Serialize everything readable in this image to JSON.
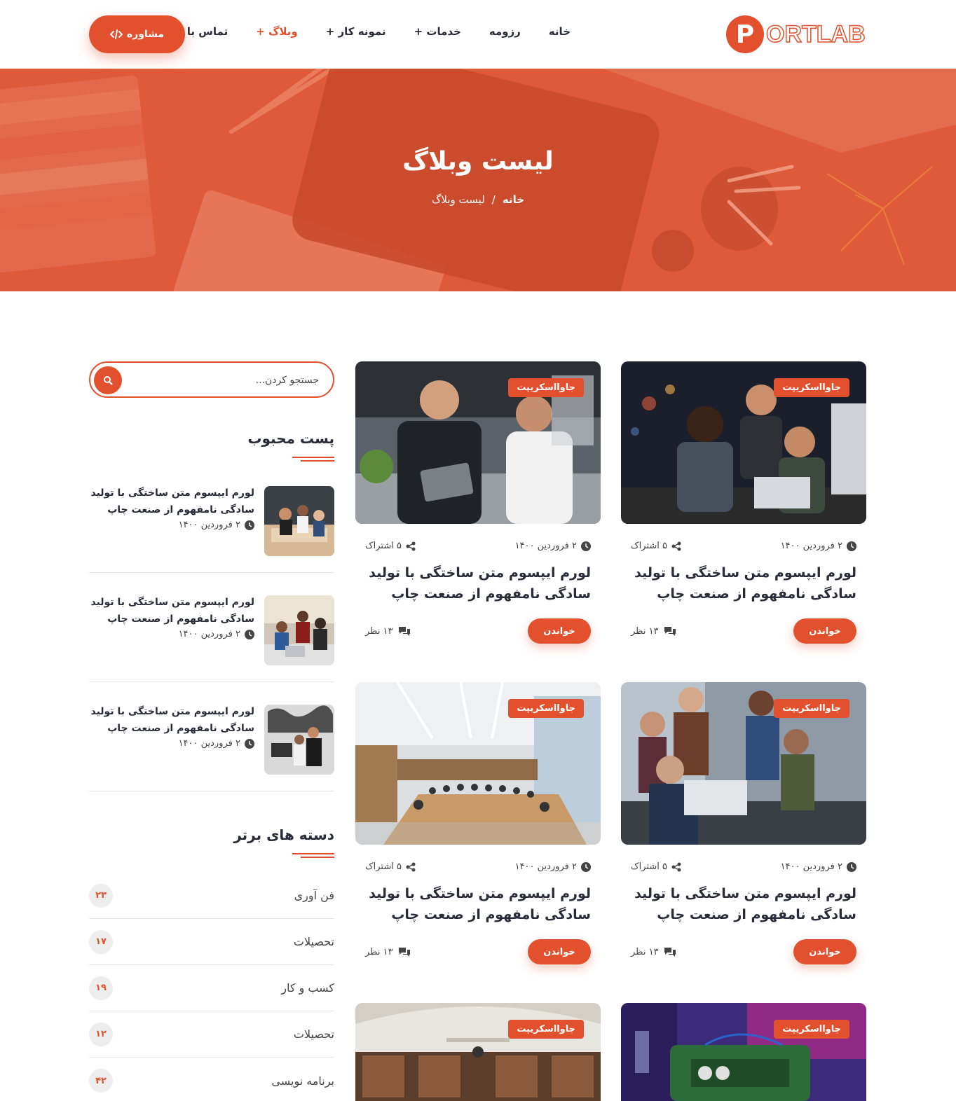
{
  "header": {
    "logo_letter": "P",
    "logo_text": "ORTLAB",
    "nav": [
      {
        "label": "خانه"
      },
      {
        "label": "رزومه"
      },
      {
        "label": "خدمات +"
      },
      {
        "label": "نمونه کار +"
      },
      {
        "label": "وبلاگ +"
      },
      {
        "label": "تماس با ما"
      }
    ],
    "consult_label": "مشاوره",
    "consult_icon": "code-icon",
    "brand_color": "#e2502e"
  },
  "hero": {
    "title": "لیست وبلاگ",
    "breadcrumb": {
      "home": "خانه",
      "separator": "/",
      "current": "لیست وبلاگ"
    }
  },
  "sidebar": {
    "search": {
      "placeholder": "جستجو کردن..."
    },
    "popular": {
      "title": "پست محبوب",
      "items": [
        {
          "title": "لورم ایپسوم متن ساختگی با تولید سادگی نامفهوم از صنعت چاپ",
          "date": "۲ فروردین ۱۴۰۰"
        },
        {
          "title": "لورم ایپسوم متن ساختگی با تولید سادگی نامفهوم از صنعت چاپ",
          "date": "۲ فروردین ۱۴۰۰"
        },
        {
          "title": "لورم ایپسوم متن ساختگی با تولید سادگی نامفهوم از صنعت چاپ",
          "date": "۲ فروردین ۱۴۰۰"
        }
      ]
    },
    "categories": {
      "title": "دسته های برتر",
      "items": [
        {
          "name": "فن آوری",
          "count": "۲۳"
        },
        {
          "name": "تحصیلات",
          "count": "۱۷"
        },
        {
          "name": "کسب و کار",
          "count": "۱۹"
        },
        {
          "name": "تحصیلات",
          "count": "۱۲"
        },
        {
          "name": "برنامه نویسی",
          "count": "۴۲"
        }
      ]
    }
  },
  "posts": [
    {
      "tag": "جاوااسکریپت",
      "date": "۲ فروردین ۱۴۰۰",
      "shares": "۵ اشتراک",
      "title_line1": "لورم ایپسوم متن ساختگی با تولید",
      "title_line2": "سادگی نامفهوم از صنعت چاپ",
      "read": "خواندن",
      "comments": "۱۳ نظر"
    },
    {
      "tag": "جاوااسکریپت",
      "date": "۲ فروردین ۱۴۰۰",
      "shares": "۵ اشتراک",
      "title_line1": "لورم ایپسوم متن ساختگی با تولید",
      "title_line2": "سادگی نامفهوم از صنعت چاپ",
      "read": "خواندن",
      "comments": "۱۳ نظر"
    },
    {
      "tag": "جاوااسکریپت",
      "date": "۲ فروردین ۱۴۰۰",
      "shares": "۵ اشتراک",
      "title_line1": "لورم ایپسوم متن ساختگی با تولید",
      "title_line2": "سادگی نامفهوم از صنعت چاپ",
      "read": "خواندن",
      "comments": "۱۳ نظر"
    },
    {
      "tag": "جاوااسکریپت",
      "date": "۲ فروردین ۱۴۰۰",
      "shares": "۵ اشتراک",
      "title_line1": "لورم ایپسوم متن ساختگی با تولید",
      "title_line2": "سادگی نامفهوم از صنعت چاپ",
      "read": "خواندن",
      "comments": "۱۳ نظر"
    },
    {
      "tag": "جاوااسکریپت"
    },
    {
      "tag": "جاوااسکریپت"
    }
  ]
}
